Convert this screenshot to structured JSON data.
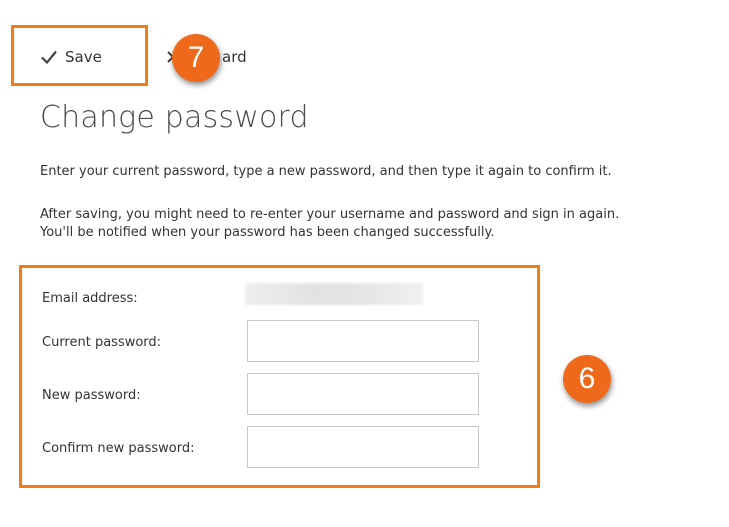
{
  "toolbar": {
    "save_label": "Save",
    "discard_label": "ard"
  },
  "badges": {
    "save_step": "7",
    "form_step": "6"
  },
  "title": "Change password",
  "description": {
    "line1": "Enter your current password, type a new password, and then type it again to confirm it.",
    "line2": "After saving, you might need to re-enter your username and password and sign in again.",
    "line3": "You'll be notified when your password has been changed successfully."
  },
  "form": {
    "email_label": "Email address:",
    "current_password_label": "Current password:",
    "new_password_label": "New password:",
    "confirm_password_label": "Confirm new password:",
    "current_password_value": "",
    "new_password_value": "",
    "confirm_password_value": ""
  },
  "colors": {
    "highlight": "#f07d18",
    "badge": "#ee6a1a"
  },
  "icons": {
    "save": "checkmark-icon",
    "discard": "close-icon"
  }
}
